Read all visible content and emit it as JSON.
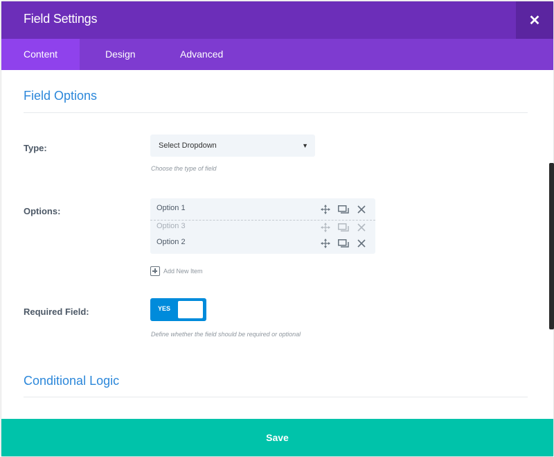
{
  "header": {
    "title": "Field Settings",
    "close_glyph": "✕"
  },
  "tabs": [
    {
      "label": "Content",
      "active": true
    },
    {
      "label": "Design",
      "active": false
    },
    {
      "label": "Advanced",
      "active": false
    }
  ],
  "field_options": {
    "section_title": "Field Options",
    "type": {
      "label": "Type:",
      "value": "Select Dropdown",
      "hint": "Choose the type of field"
    },
    "options": {
      "label": "Options:",
      "items": [
        {
          "label": "Option 1",
          "dragging": false
        },
        {
          "label": "Option 3",
          "dragging": true
        },
        {
          "label": "Option 2",
          "dragging": false
        }
      ],
      "add_label": "Add New Item"
    },
    "required": {
      "label": "Required Field:",
      "toggle_text": "YES",
      "value": true,
      "hint": "Define whether the field should be required or optional"
    }
  },
  "conditional_logic": {
    "section_title": "Conditional Logic"
  },
  "footer": {
    "save_label": "Save"
  },
  "colors": {
    "header": "#6c2eb9",
    "tabs": "#7e3bd0",
    "accent_blue": "#2b87da",
    "toggle": "#008bdb",
    "save": "#00c3aa"
  },
  "icons": [
    "close-icon",
    "dropdown-arrow-icon",
    "move-icon",
    "duplicate-icon",
    "delete-icon",
    "plus-icon"
  ]
}
